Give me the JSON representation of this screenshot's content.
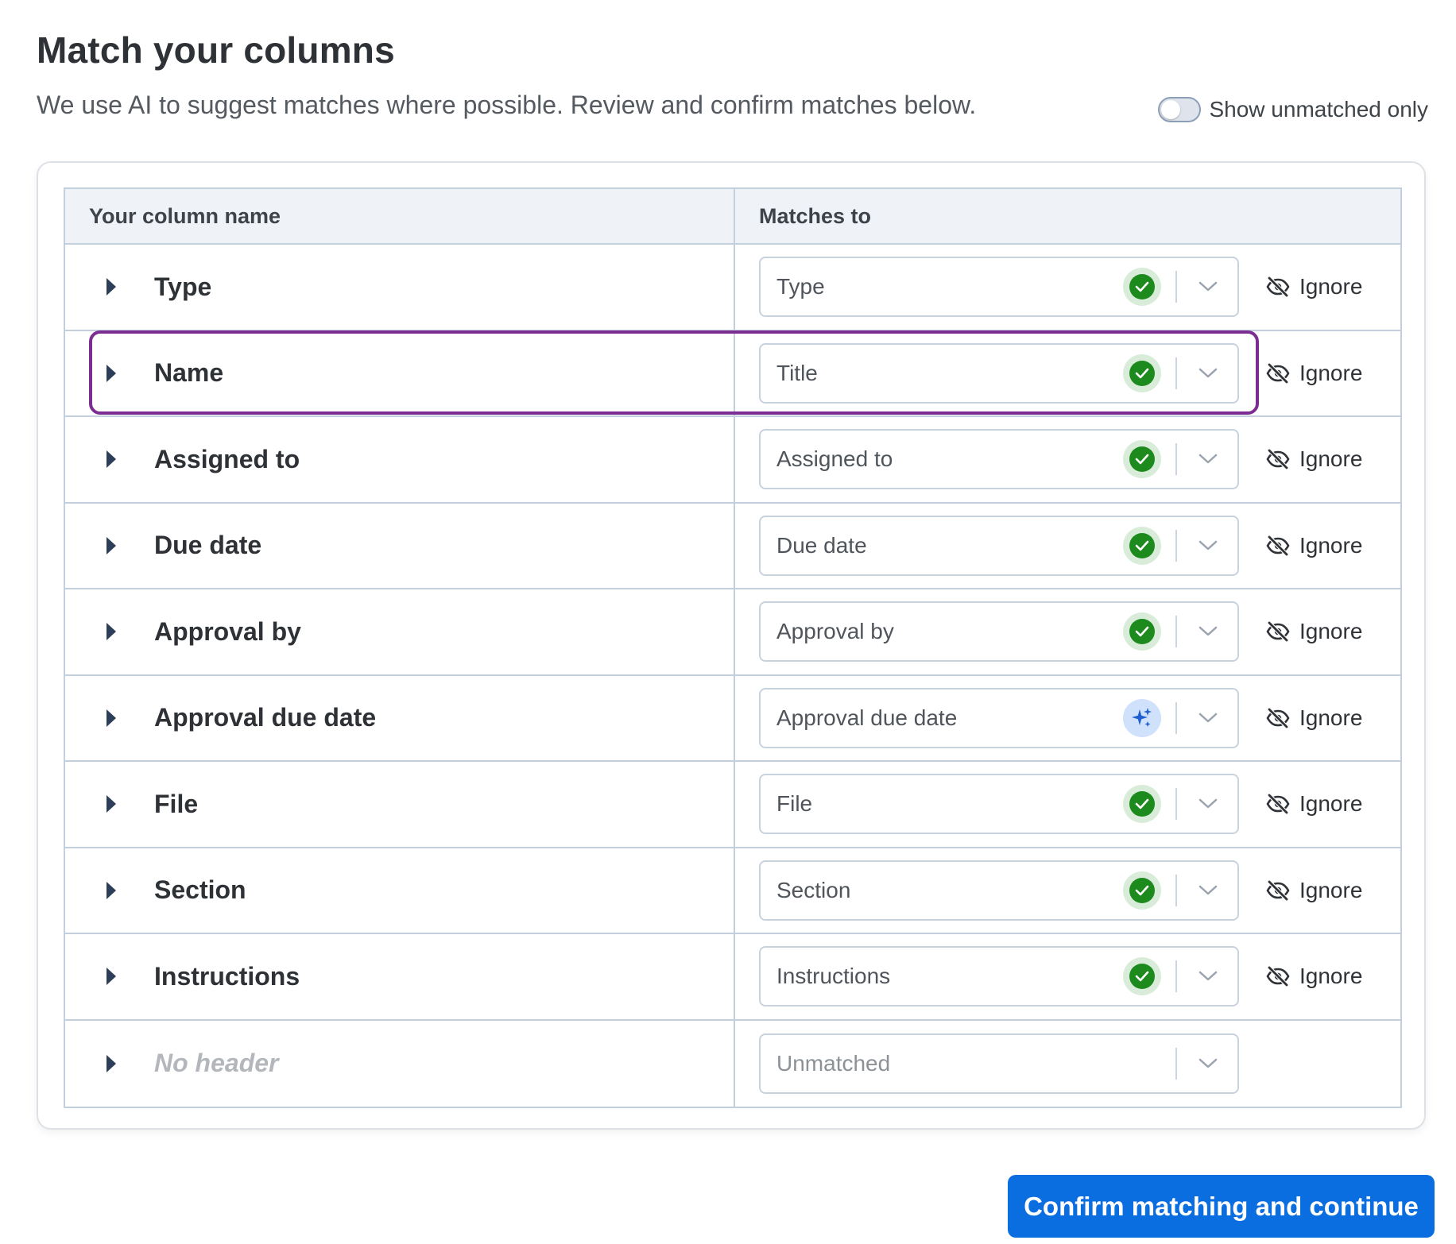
{
  "header": {
    "title": "Match your columns",
    "subtitle": "We use AI to suggest matches where possible. Review and confirm matches below."
  },
  "toggle": {
    "label": "Show unmatched only",
    "on": false
  },
  "table": {
    "columns": [
      "Your column name",
      "Matches to"
    ],
    "rows": [
      {
        "name": "Type",
        "match": "Type",
        "status": "confirmed",
        "ignore": "Ignore"
      },
      {
        "name": "Name",
        "match": "Title",
        "status": "confirmed",
        "ignore": "Ignore"
      },
      {
        "name": "Assigned to",
        "match": "Assigned to",
        "status": "confirmed",
        "ignore": "Ignore"
      },
      {
        "name": "Due date",
        "match": "Due date",
        "status": "confirmed",
        "ignore": "Ignore"
      },
      {
        "name": "Approval by",
        "match": "Approval by",
        "status": "confirmed",
        "ignore": "Ignore"
      },
      {
        "name": "Approval due date",
        "match": "Approval due date",
        "status": "ai-suggested",
        "ignore": "Ignore"
      },
      {
        "name": "File",
        "match": "File",
        "status": "confirmed",
        "ignore": "Ignore"
      },
      {
        "name": "Section",
        "match": "Section",
        "status": "confirmed",
        "ignore": "Ignore"
      },
      {
        "name": "Instructions",
        "match": "Instructions",
        "status": "confirmed",
        "ignore": "Ignore"
      },
      {
        "name": "No header",
        "match": "Unmatched",
        "status": "unmatched",
        "ignore": ""
      }
    ]
  },
  "icons": {
    "expand": "caret-right-icon",
    "confirmed": "check-circle-icon",
    "ai": "sparkle-icon",
    "dropdown": "chevron-down-icon",
    "ignore": "eye-slash-icon"
  },
  "colors": {
    "primary": "#0a6de0",
    "success": "#1c8a1c",
    "highlight": "#7b2d91",
    "ai_bg": "#cfe1fb",
    "ai_icon": "#1f5fd1"
  },
  "footer": {
    "confirm_label": "Confirm matching and continue"
  }
}
